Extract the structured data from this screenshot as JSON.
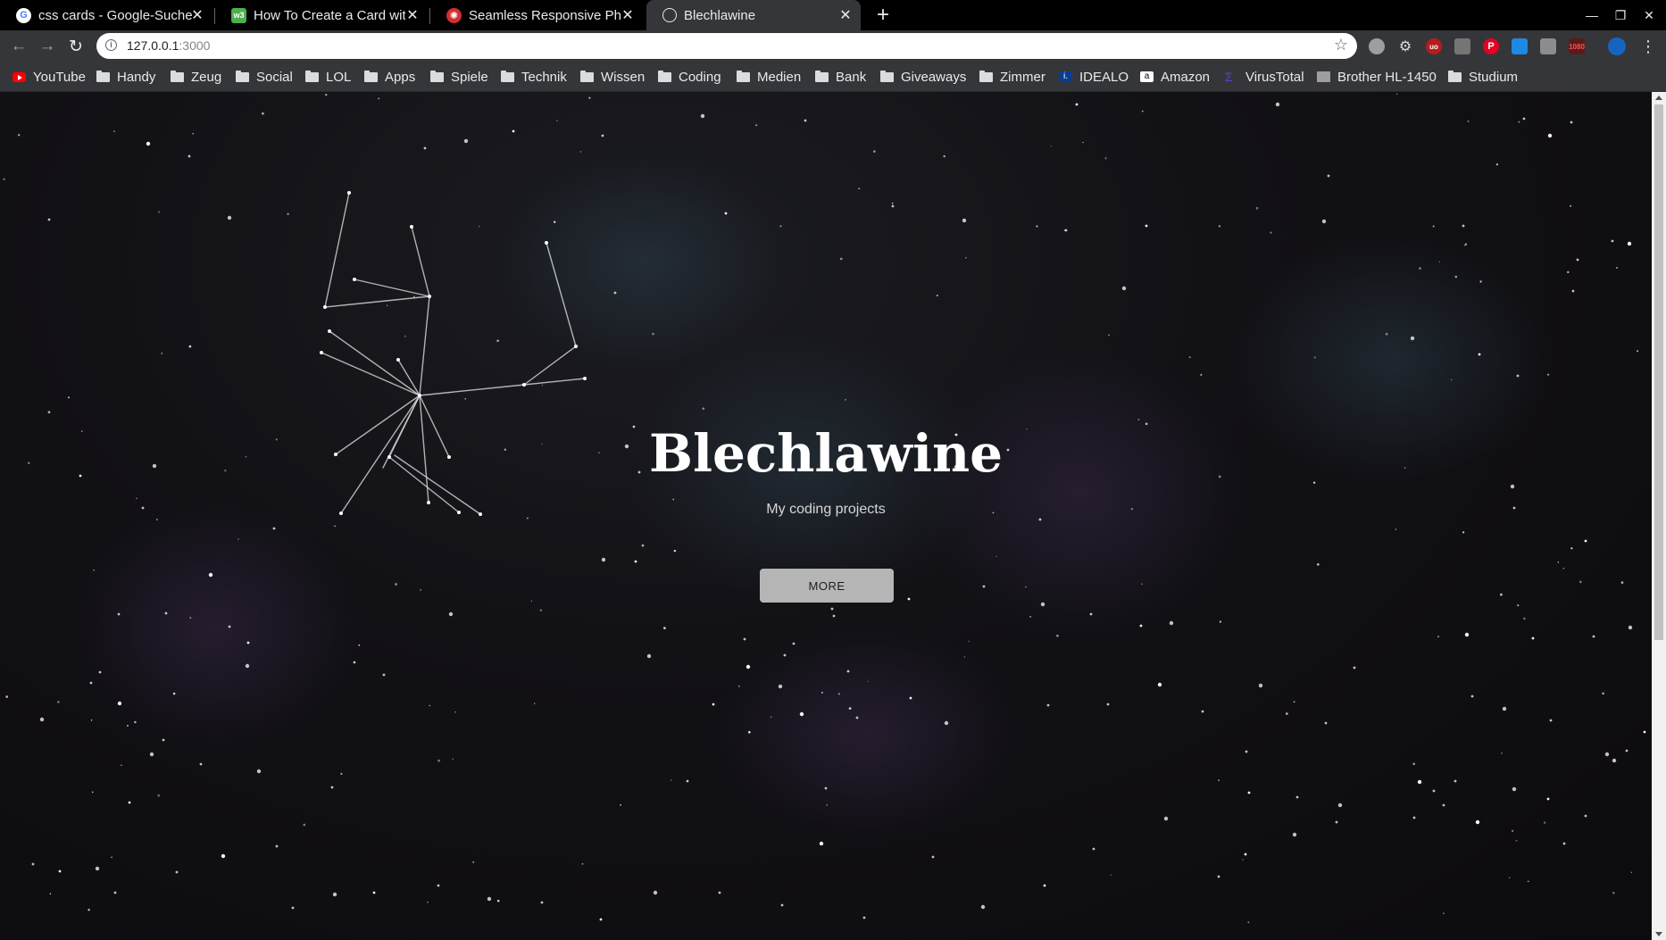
{
  "tabs": [
    {
      "title": "css cards - Google-Suche",
      "favicon": "google-icon",
      "active": false
    },
    {
      "title": "How To Create a Card with",
      "favicon": "w3schools-icon",
      "active": false
    },
    {
      "title": "Seamless Responsive Phot",
      "favicon": "codepen-icon",
      "active": false
    },
    {
      "title": "Blechlawine",
      "favicon": "globe-icon",
      "active": true
    }
  ],
  "address_bar": {
    "host": "127.0.0.1",
    "port": ":3000"
  },
  "bookmarks": [
    {
      "label": "YouTube",
      "icon": "youtube-icon"
    },
    {
      "label": "Handy",
      "icon": "folder-icon"
    },
    {
      "label": "Zeug",
      "icon": "folder-icon"
    },
    {
      "label": "Social",
      "icon": "folder-icon"
    },
    {
      "label": "LOL",
      "icon": "folder-icon"
    },
    {
      "label": "Apps",
      "icon": "folder-icon"
    },
    {
      "label": "Spiele",
      "icon": "folder-icon"
    },
    {
      "label": "Technik",
      "icon": "folder-icon"
    },
    {
      "label": "Wissen",
      "icon": "folder-icon"
    },
    {
      "label": "Coding",
      "icon": "folder-icon"
    },
    {
      "label": "Medien",
      "icon": "folder-icon"
    },
    {
      "label": "Bank",
      "icon": "folder-icon"
    },
    {
      "label": "Giveaways",
      "icon": "folder-icon"
    },
    {
      "label": "Zimmer",
      "icon": "folder-icon"
    },
    {
      "label": "IDEALO",
      "icon": "idealo-icon"
    },
    {
      "label": "Amazon",
      "icon": "amazon-icon"
    },
    {
      "label": "VirusTotal",
      "icon": "virustotal-icon"
    },
    {
      "label": "Brother HL-1450",
      "icon": "brother-icon"
    },
    {
      "label": "Studium",
      "icon": "folder-icon"
    }
  ],
  "hero": {
    "title": "Blechlawine",
    "subtitle": "My coding projects",
    "button_label": "MORE"
  },
  "colors": {
    "page_background": "#0b0a0d",
    "button_background": "#b5b5b5",
    "tab_active": "#35363a",
    "constellation_line": "#cfcfcf"
  }
}
